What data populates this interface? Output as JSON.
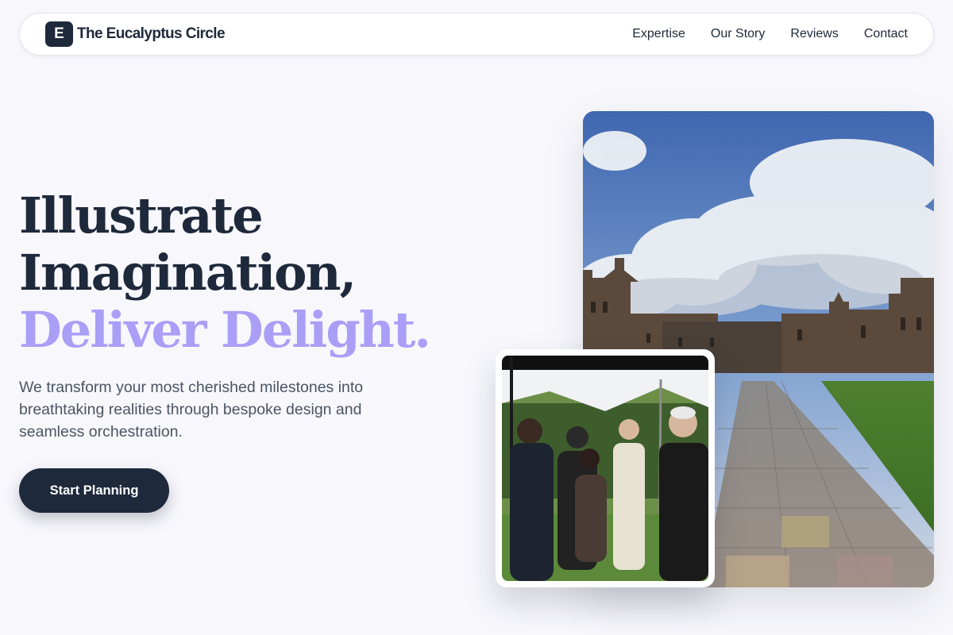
{
  "nav": {
    "logo_letter": "E",
    "brand_name": "The Eucalyptus Circle",
    "links": [
      "Expertise",
      "Our Story",
      "Reviews",
      "Contact"
    ]
  },
  "hero": {
    "title_line1": "Illustrate",
    "title_line2": "Imagination,",
    "title_line3": "Deliver Delight.",
    "subtitle": "We transform your most cherished milestones into breathtaking realities through bespoke design and seamless orchestration.",
    "cta_label": "Start Planning"
  },
  "colors": {
    "primary": "#1e293b",
    "accent": "#ab9ef7",
    "background": "#f7f7fc",
    "muted_text": "#4b5563"
  },
  "icons": {
    "logo": "letter-e-logo-icon"
  }
}
